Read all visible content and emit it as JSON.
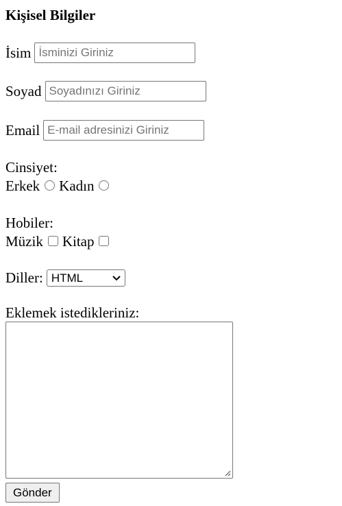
{
  "form": {
    "title": "Kişisel Bilgiler",
    "name": {
      "label": "İsim",
      "placeholder": "İsminizi Giriniz",
      "value": ""
    },
    "surname": {
      "label": "Soyad",
      "placeholder": "Soyadınızı Giriniz",
      "value": ""
    },
    "email": {
      "label": "Email",
      "placeholder": "E-mail adresinizi Giriniz",
      "value": ""
    },
    "gender": {
      "label": "Cinsiyet:",
      "options": [
        {
          "label": "Erkek",
          "checked": false
        },
        {
          "label": "Kadın",
          "checked": false
        }
      ]
    },
    "hobbies": {
      "label": "Hobiler:",
      "options": [
        {
          "label": "Müzik",
          "checked": false
        },
        {
          "label": "Kitap",
          "checked": false
        }
      ]
    },
    "languages": {
      "label": "Diller:",
      "selected": "HTML"
    },
    "notes": {
      "label": "Eklemek istedikleriniz:",
      "value": ""
    },
    "submit_label": "Gönder"
  },
  "icons": {
    "select_arrow": "chevron-down-icon",
    "resize": "resize-grip-icon"
  }
}
